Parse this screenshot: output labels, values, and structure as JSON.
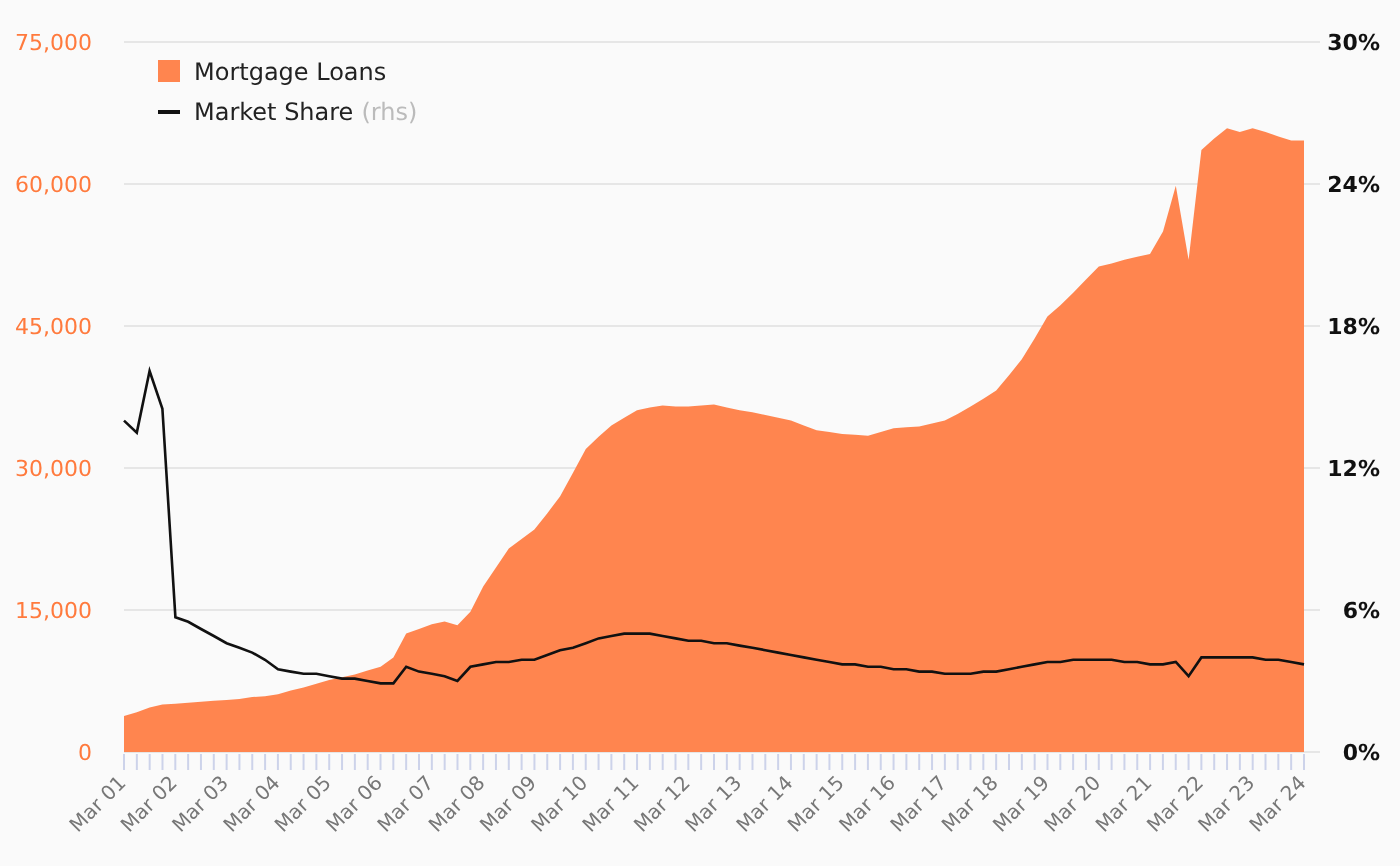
{
  "chart_data": {
    "type": "area",
    "ylim": [
      0,
      75000
    ],
    "grid": true,
    "legend": true,
    "categories": [
      "Mar 01",
      null,
      null,
      null,
      "Mar 02",
      null,
      null,
      null,
      "Mar 03",
      null,
      null,
      null,
      "Mar 04",
      null,
      null,
      null,
      "Mar 05",
      null,
      null,
      null,
      "Mar 06",
      null,
      null,
      null,
      "Mar 07",
      null,
      null,
      null,
      "Mar 08",
      null,
      null,
      null,
      "Mar 09",
      null,
      null,
      null,
      "Mar 10",
      null,
      null,
      null,
      "Mar 11",
      null,
      null,
      null,
      "Mar 12",
      null,
      null,
      null,
      "Mar 13",
      null,
      null,
      null,
      "Mar 14",
      null,
      null,
      null,
      "Mar 15",
      null,
      null,
      null,
      "Mar 16",
      null,
      null,
      null,
      "Mar 17",
      null,
      null,
      null,
      "Mar 18",
      null,
      null,
      null,
      "Mar 19",
      null,
      null,
      null,
      "Mar 20",
      null,
      null,
      null,
      "Mar 21",
      null,
      null,
      null,
      "Mar 22",
      null,
      null,
      null,
      "Mar 23",
      null,
      null,
      null,
      "Mar 24"
    ],
    "yticks": [
      {
        "value": 0,
        "label": "0"
      },
      {
        "value": 15000,
        "label": "15,000"
      },
      {
        "value": 30000,
        "label": "30,000"
      },
      {
        "value": 45000,
        "label": "45,000"
      },
      {
        "value": 60000,
        "label": "60,000"
      },
      {
        "value": 75000,
        "label": "75,000"
      }
    ],
    "y2lim": [
      0,
      30
    ],
    "y2ticks": [
      {
        "value": 0,
        "label": "0%"
      },
      {
        "value": 6,
        "label": "6%"
      },
      {
        "value": 12,
        "label": "12%"
      },
      {
        "value": 18,
        "label": "18%"
      },
      {
        "value": 24,
        "label": "24%"
      },
      {
        "value": 30,
        "label": "30%"
      }
    ],
    "series": [
      {
        "name": "Mortgage Loans",
        "color": "#ff854f",
        "values": [
          3800,
          4200,
          4700,
          5000,
          5100,
          5200,
          5300,
          5400,
          5500,
          5600,
          5800,
          5900,
          6100,
          6500,
          6800,
          7200,
          7600,
          7900,
          8200,
          8600,
          9000,
          10000,
          12500,
          13000,
          13500,
          13800,
          13400,
          14800,
          17500,
          19500,
          21500,
          22500,
          23500,
          25200,
          27000,
          29500,
          32000,
          33300,
          34500,
          35300,
          36100,
          36400,
          36600,
          36500,
          36500,
          36600,
          36700,
          36400,
          36100,
          35900,
          35600,
          35300,
          35000,
          34500,
          34000,
          33800,
          33600,
          33500,
          33400,
          33800,
          34200,
          34300,
          34400,
          34700,
          35000,
          35700,
          36500,
          37300,
          38200,
          39800,
          41500,
          43700,
          46000,
          47200,
          48500,
          49900,
          51300,
          51600,
          52000,
          52300,
          52600,
          55000,
          59800,
          52000,
          63600,
          64800,
          65900,
          65500,
          65900,
          65500,
          65000,
          64600,
          64600
        ]
      },
      {
        "name": "Market Share",
        "color": "#111111",
        "type": "line",
        "axis": "y2",
        "values": [
          14.0,
          13.5,
          16.1,
          14.5,
          5.7,
          5.5,
          5.2,
          4.9,
          4.6,
          4.4,
          4.2,
          3.9,
          3.5,
          3.4,
          3.3,
          3.3,
          3.2,
          3.1,
          3.1,
          3.0,
          2.9,
          2.9,
          3.6,
          3.4,
          3.3,
          3.2,
          3.0,
          3.6,
          3.7,
          3.8,
          3.8,
          3.9,
          3.9,
          4.1,
          4.3,
          4.4,
          4.6,
          4.8,
          4.9,
          5.0,
          5.0,
          5.0,
          4.9,
          4.8,
          4.7,
          4.7,
          4.6,
          4.6,
          4.5,
          4.4,
          4.3,
          4.2,
          4.1,
          4.0,
          3.9,
          3.8,
          3.7,
          3.7,
          3.6,
          3.6,
          3.5,
          3.5,
          3.4,
          3.4,
          3.3,
          3.3,
          3.3,
          3.4,
          3.4,
          3.5,
          3.6,
          3.7,
          3.8,
          3.8,
          3.9,
          3.9,
          3.9,
          3.9,
          3.8,
          3.8,
          3.7,
          3.7,
          3.8,
          3.2,
          4.0,
          4.0,
          4.0,
          4.0,
          4.0,
          3.9,
          3.9,
          3.8,
          3.7
        ]
      }
    ]
  },
  "legend_note": "(rhs)"
}
